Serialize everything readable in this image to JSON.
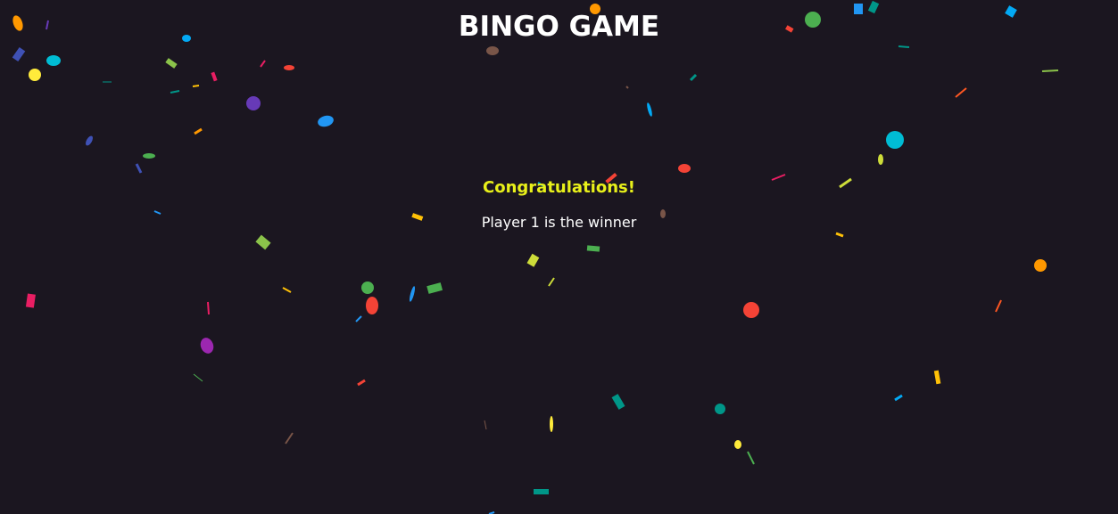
{
  "header": {
    "title": "BINGO GAME"
  },
  "result": {
    "headline": "Congratulations!",
    "message": "Player 1 is the winner"
  },
  "colors": {
    "background": "#1b1620",
    "title": "#ffffff",
    "headline": "#e8f01a",
    "message": "#ffffff",
    "confetti_palette": [
      "#ff9800",
      "#4caf50",
      "#2196f3",
      "#00bcd4",
      "#f44336",
      "#e91e63",
      "#cddc39",
      "#8bc34a",
      "#673ab7",
      "#3f51b5",
      "#ffc107",
      "#009688",
      "#795548",
      "#9c27b0",
      "#ffeb3b",
      "#ff5722",
      "#03a9f4"
    ]
  }
}
